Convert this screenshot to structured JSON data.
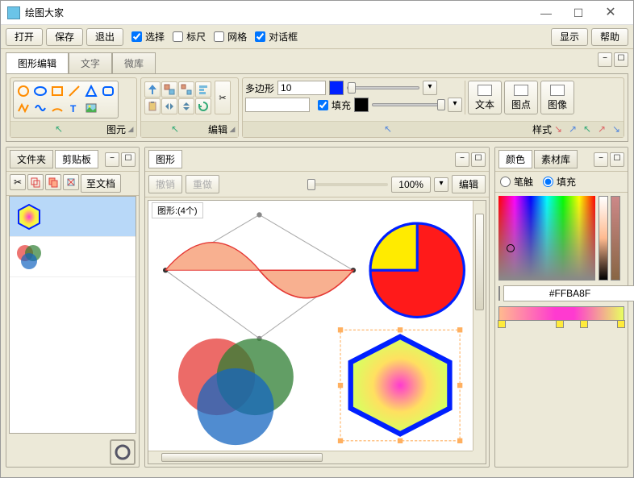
{
  "window": {
    "title": "绘图大家"
  },
  "menu": {
    "open": "打开",
    "save": "保存",
    "exit": "退出",
    "select": "选择",
    "ruler": "标尺",
    "grid": "网格",
    "dialog": "对话框",
    "show": "显示",
    "help": "帮助"
  },
  "ribbon": {
    "tab_graphics_edit": "图形编辑",
    "tab_text": "文字",
    "tab_micro": "微库",
    "group_primitive": "图元",
    "group_edit": "编辑",
    "group_style": "样式",
    "polygon_label": "多边形",
    "polygon_sides": "10",
    "fill_label": "填充",
    "btn_text": "文本",
    "btn_point": "图点",
    "btn_image": "图像"
  },
  "left": {
    "tab_folder": "文件夹",
    "tab_clip": "剪贴板",
    "to_doc": "至文档"
  },
  "center": {
    "title": "图形",
    "undo": "撤销",
    "redo": "重做",
    "zoom": "100%",
    "edit": "编辑",
    "canvas_label": "图形:(4个)"
  },
  "right": {
    "tab_color": "颜色",
    "tab_matlib": "素材库",
    "stroke": "笔触",
    "fill": "填充",
    "hex": "#FFBA8F"
  }
}
